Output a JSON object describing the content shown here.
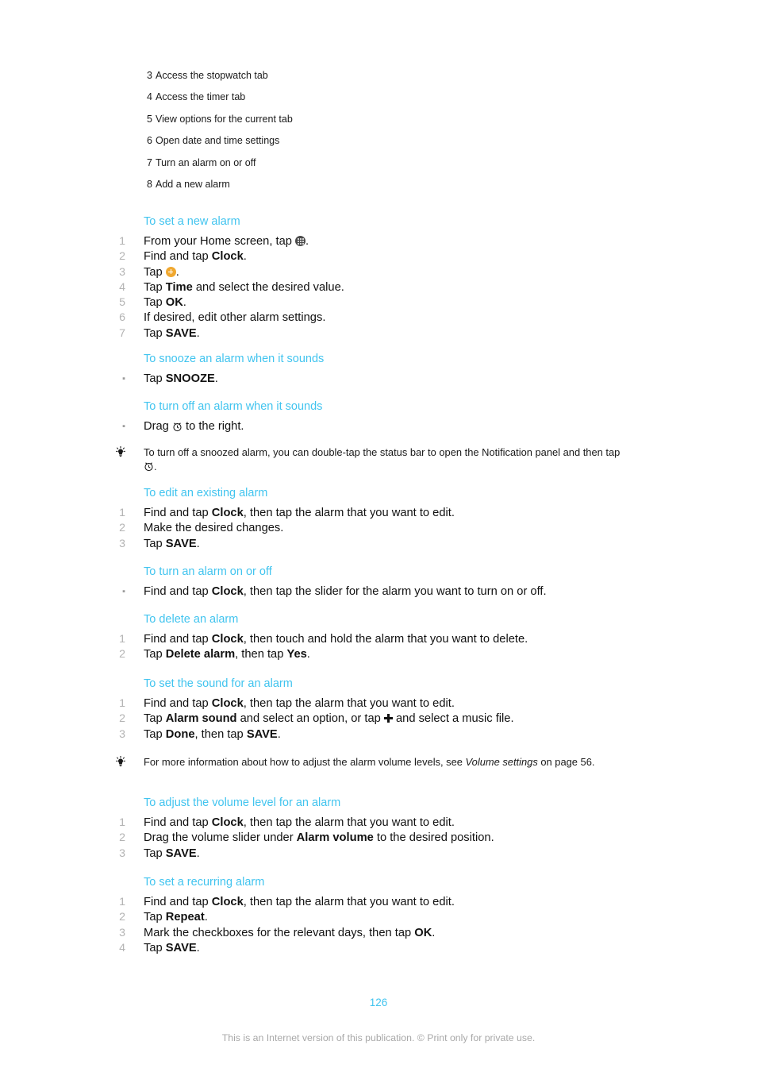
{
  "legend": {
    "rows": [
      {
        "num": "3",
        "text": "Access the stopwatch tab"
      },
      {
        "num": "4",
        "text": "Access the timer tab"
      },
      {
        "num": "5",
        "text": "View options for the current tab"
      },
      {
        "num": "6",
        "text": "Open date and time settings"
      },
      {
        "num": "7",
        "text": "Turn an alarm on or off"
      },
      {
        "num": "8",
        "text": "Add a new alarm"
      }
    ]
  },
  "colors": {
    "heading": "#41c4ef",
    "page_number": "#41c4ef",
    "step_number": "#b3b3b3",
    "footer": "#a8a8a8",
    "plus_circle_icon": "#f0a830",
    "app_drawer_icon": "#4a4a4a"
  },
  "sections": {
    "set_new_alarm": {
      "heading": "To set a new alarm",
      "steps": {
        "s1_num": "1",
        "s1_a": "From your Home screen, tap ",
        "s1_b": ".",
        "s2_num": "2",
        "s2_a": "Find and tap ",
        "s2_bold": "Clock",
        "s2_b": ".",
        "s3_num": "3",
        "s3_a": "Tap ",
        "s3_b": ".",
        "s4_num": "4",
        "s4_a": "Tap ",
        "s4_bold": "Time",
        "s4_b": " and select the desired value.",
        "s5_num": "5",
        "s5_a": "Tap ",
        "s5_bold": "OK",
        "s5_b": ".",
        "s6_num": "6",
        "s6_a": "If desired, edit other alarm settings.",
        "s7_num": "7",
        "s7_a": "Tap ",
        "s7_bold": "SAVE",
        "s7_b": "."
      }
    },
    "snooze_alarm": {
      "heading": "To snooze an alarm when it sounds",
      "bullet_a": "Tap ",
      "bullet_bold": "SNOOZE",
      "bullet_b": "."
    },
    "turn_off_alarm": {
      "heading": "To turn off an alarm when it sounds",
      "bullet_a": "Drag ",
      "bullet_b": " to the right.",
      "tip_a": "To turn off a snoozed alarm, you can double-tap the status bar to open the Notification panel and then tap ",
      "tip_b": "."
    },
    "edit_alarm": {
      "heading": "To edit an existing alarm",
      "steps": {
        "s1_num": "1",
        "s1_a": "Find and tap ",
        "s1_bold": "Clock",
        "s1_b": ", then tap the alarm that you want to edit.",
        "s2_num": "2",
        "s2_a": "Make the desired changes.",
        "s3_num": "3",
        "s3_a": "Tap ",
        "s3_bold": "SAVE",
        "s3_b": "."
      }
    },
    "turn_on_off_alarm": {
      "heading": "To turn an alarm on or off",
      "bullet_a": "Find and tap ",
      "bullet_bold": "Clock",
      "bullet_b": ", then tap the slider for the alarm you want to turn on or off."
    },
    "delete_alarm": {
      "heading": "To delete an alarm",
      "steps": {
        "s1_num": "1",
        "s1_a": "Find and tap ",
        "s1_bold": "Clock",
        "s1_b": ", then touch and hold the alarm that you want to delete.",
        "s2_num": "2",
        "s2_a": "Tap ",
        "s2_bold1": "Delete alarm",
        "s2_mid": ", then tap ",
        "s2_bold2": "Yes",
        "s2_b": "."
      }
    },
    "set_sound": {
      "heading": "To set the sound for an alarm",
      "steps": {
        "s1_num": "1",
        "s1_a": "Find and tap ",
        "s1_bold": "Clock",
        "s1_b": ", then tap the alarm that you want to edit.",
        "s2_num": "2",
        "s2_a": "Tap ",
        "s2_bold": "Alarm sound",
        "s2_mid": " and select an option, or tap ",
        "s2_b": " and select a music file.",
        "s3_num": "3",
        "s3_a": "Tap ",
        "s3_bold1": "Done",
        "s3_mid": ", then tap ",
        "s3_bold2": "SAVE",
        "s3_b": "."
      },
      "tip_a": "For more information about how to adjust the alarm volume levels, see ",
      "tip_italic": "Volume settings",
      "tip_b": " on page 56."
    },
    "adjust_volume": {
      "heading": "To adjust the volume level for an alarm",
      "steps": {
        "s1_num": "1",
        "s1_a": "Find and tap ",
        "s1_bold": "Clock",
        "s1_b": ", then tap the alarm that you want to edit.",
        "s2_num": "2",
        "s2_a": "Drag the volume slider under ",
        "s2_bold": "Alarm volume",
        "s2_b": " to the desired position.",
        "s3_num": "3",
        "s3_a": "Tap ",
        "s3_bold": "SAVE",
        "s3_b": "."
      }
    },
    "recurring_alarm": {
      "heading": "To set a recurring alarm",
      "steps": {
        "s1_num": "1",
        "s1_a": "Find and tap ",
        "s1_bold": "Clock",
        "s1_b": ", then tap the alarm that you want to edit.",
        "s2_num": "2",
        "s2_a": "Tap ",
        "s2_bold": "Repeat",
        "s2_b": ".",
        "s3_num": "3",
        "s3_a": "Mark the checkboxes for the relevant days, then tap ",
        "s3_bold": "OK",
        "s3_b": ".",
        "s4_num": "4",
        "s4_a": "Tap ",
        "s4_bold": "SAVE",
        "s4_b": "."
      }
    }
  },
  "footer": {
    "page_number": "126",
    "note": "This is an Internet version of this publication. © Print only for private use."
  }
}
